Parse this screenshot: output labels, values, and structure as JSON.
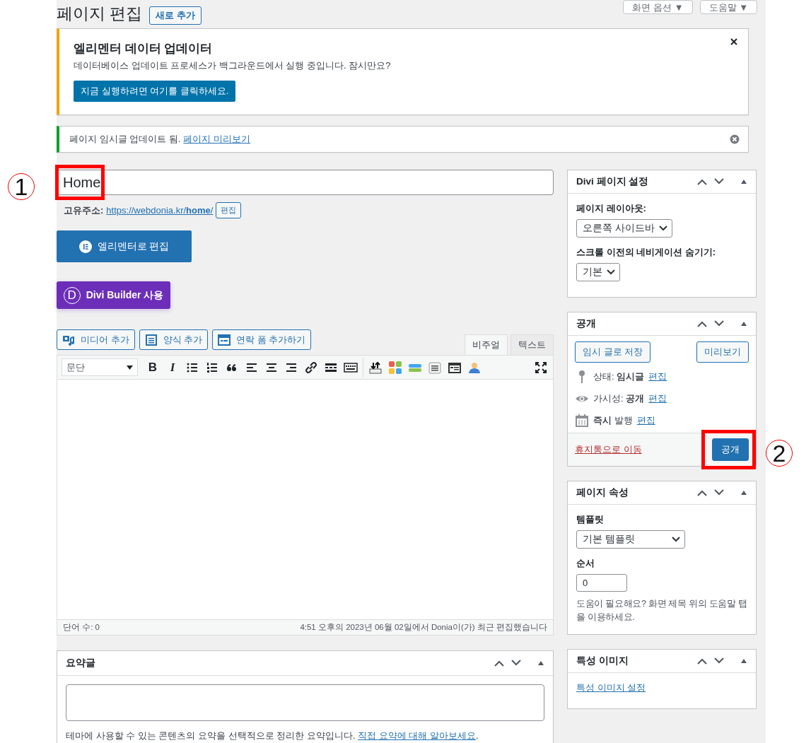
{
  "header": {
    "title": "페이지 편집",
    "add_new": "새로 추가",
    "screen_options": "화면 옵션 ▼",
    "help": "도움말 ▼"
  },
  "elementor_notice": {
    "title": "엘리멘터 데이터 업데이터",
    "message": "데이터베이스 업데이트 프로세스가 백그라운드에서 실행 중입니다. 잠시만요?",
    "button": "지금 실행하려면 여기를 클릭하세요."
  },
  "update_notice": {
    "message": "페이지 임시글 업데이트 됨.",
    "link": "페이지 미리보기"
  },
  "post_title": {
    "value": "Home"
  },
  "permalink": {
    "label": "고유주소:",
    "url": "https://webdonia.kr/**home**/",
    "edit": "편집"
  },
  "elementor_button": "엘리멘터로 편집",
  "divi_button": {
    "logo": "D",
    "label": "Divi Builder 사용"
  },
  "media_buttons": [
    {
      "kind": "media",
      "label": "미디어 추가"
    },
    {
      "kind": "form",
      "label": "양식 추가"
    },
    {
      "kind": "contact",
      "label": "연락 폼 추가하기"
    }
  ],
  "editor_tabs": [
    {
      "label": "비주얼",
      "selected": true
    },
    {
      "label": "텍스트",
      "selected": false
    }
  ],
  "format_select": "문단",
  "toolbar": [
    {
      "kind": "text",
      "label": "B"
    },
    {
      "kind": "italic",
      "label": "I"
    },
    {
      "kind": "ul"
    },
    {
      "kind": "ol"
    },
    {
      "kind": "quote"
    },
    {
      "kind": "align-left"
    },
    {
      "kind": "align-center"
    },
    {
      "kind": "align-right"
    },
    {
      "kind": "link"
    },
    {
      "kind": "more"
    },
    {
      "kind": "keyboard"
    },
    {
      "kind": "divider"
    },
    {
      "kind": "upload"
    },
    {
      "kind": "blocks"
    },
    {
      "kind": "toggle"
    },
    {
      "kind": "list-box"
    },
    {
      "kind": "window"
    },
    {
      "kind": "person"
    },
    {
      "kind": "fullscreen"
    }
  ],
  "word_count": "단어 수: 0",
  "last_edited": "4:51 오후의 2023년 06월 02일에서 Donia이(가) 최근 편집했습니다",
  "excerpt": {
    "title": "요약글",
    "help": "테마에 사용할 수 있는 콘텐츠의 요약을 선택적으로 정리한 요약입니다.",
    "help_link": "직접 요약에 대해 알아보세요",
    "help_end": "."
  },
  "divi_settings": {
    "title": "Divi 페이지 설정",
    "fields": [
      {
        "label": "페이지 레이아웃:",
        "value": "오른쪽 사이드바"
      },
      {
        "label": "스크롤 이전의 네비게이션 숨기기:",
        "value": "기본"
      }
    ]
  },
  "publish": {
    "title": "공개",
    "save_draft": "임시 글로 저장",
    "preview": "미리보기",
    "rows": [
      {
        "kind": "status",
        "label": "상태:",
        "value": "임시글",
        "edit": "편집"
      },
      {
        "kind": "visibility",
        "label": "가시성:",
        "value": "공개",
        "edit": "편집"
      },
      {
        "kind": "schedule",
        "value": "즉시",
        "label": "발행",
        "edit": "편집"
      }
    ],
    "trash": "휴지통으로 이동",
    "publish": "공개"
  },
  "page_attributes": {
    "title": "페이지 속성",
    "template_label": "템플릿",
    "template": "기본 템플릿",
    "order_label": "순서",
    "order": "0",
    "help": "도움이 필요해요? 화면 제목 위의 도움말 탭을 이용하세요."
  },
  "featured_image": {
    "title": "특성 이미지",
    "link": "특성 이미지 설정"
  },
  "annotations": [
    {
      "label": "1"
    },
    {
      "label": "2"
    }
  ]
}
